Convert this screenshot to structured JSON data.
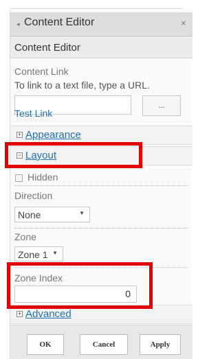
{
  "panel": {
    "title": "Content Editor",
    "collapse_glyph": "◂",
    "close_glyph": "×"
  },
  "subheader": "Content Editor",
  "content_link": {
    "label": "Content Link",
    "hint": "To link to a text file, type a URL.",
    "url_value": "",
    "browse_label": "...",
    "test_link": "Test Link"
  },
  "sections": {
    "appearance": {
      "label": "Appearance",
      "expander": "+"
    },
    "layout": {
      "label": "Layout",
      "expander": "−"
    },
    "advanced": {
      "label": "Advanced",
      "expander": "+"
    }
  },
  "layout": {
    "hidden_label": "Hidden",
    "direction_label": "Direction",
    "direction_value": "None",
    "zone_label": "Zone",
    "zone_value": "Zone 1",
    "zone_index_label": "Zone Index",
    "zone_index_value": "0"
  },
  "buttons": {
    "ok": "OK",
    "cancel": "Cancel",
    "apply": "Apply"
  },
  "icons": {
    "collapse": "left-triangle-icon",
    "close": "close-icon",
    "caret": "chevron-down-icon"
  },
  "colors": {
    "link": "#1f6fb5",
    "highlight": "#e30000"
  }
}
